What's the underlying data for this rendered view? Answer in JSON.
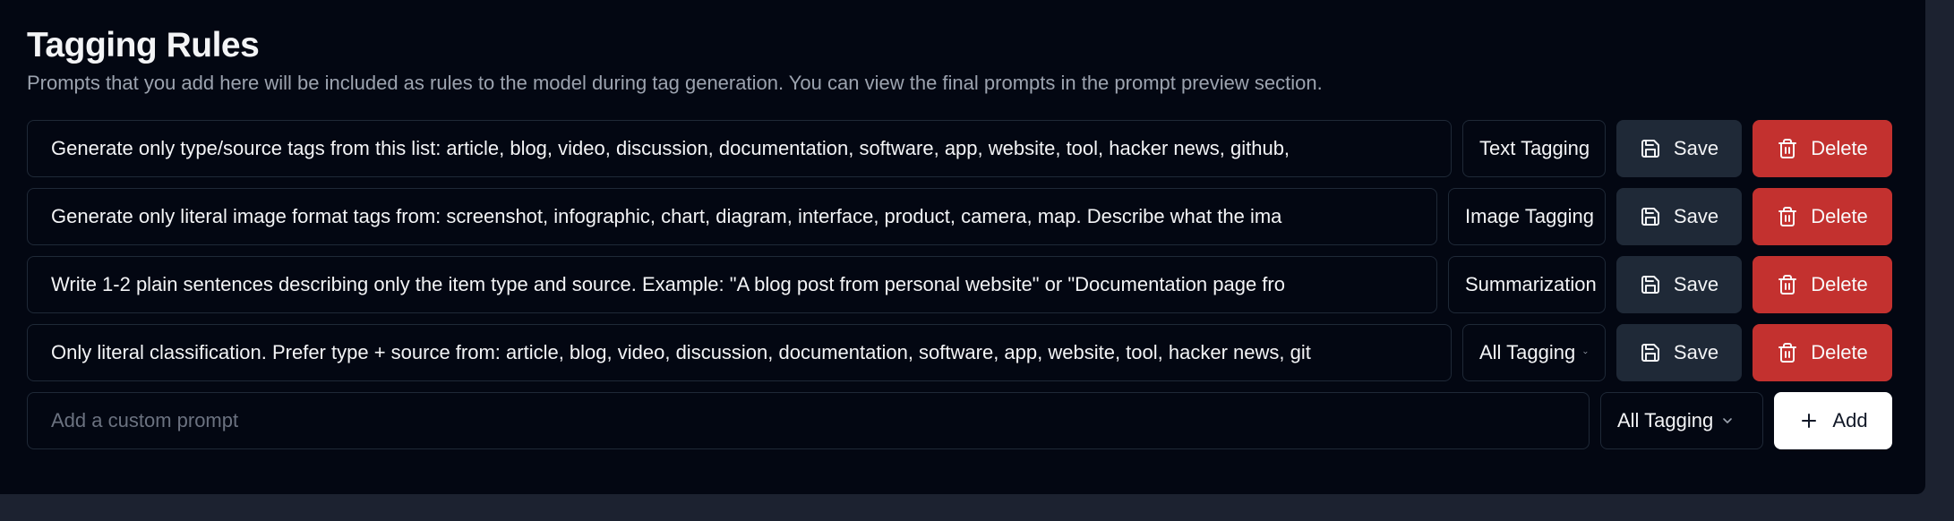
{
  "header": {
    "title": "Tagging Rules",
    "subtitle": "Prompts that you add here will be included as rules to the model during tag generation. You can view the final prompts in the prompt preview section."
  },
  "rules": [
    {
      "prompt": "Generate only type/source tags from this list: article, blog, video, discussion, documentation, software, app, website, tool, hacker news, github,",
      "type": "Text Tagging",
      "save_label": "Save",
      "delete_label": "Delete"
    },
    {
      "prompt": "Generate only literal image format tags from: screenshot, infographic, chart, diagram, interface, product, camera, map. Describe what the ima",
      "type": "Image Tagging",
      "save_label": "Save",
      "delete_label": "Delete"
    },
    {
      "prompt": "Write 1-2 plain sentences describing only the item type and source. Example: \"A blog post from personal website\" or \"Documentation page fro",
      "type": "Summarization",
      "save_label": "Save",
      "delete_label": "Delete"
    },
    {
      "prompt": "Only literal classification. Prefer type + source from: article, blog, video, discussion, documentation, software, app, website, tool, hacker news, git",
      "type": "All Tagging",
      "save_label": "Save",
      "delete_label": "Delete"
    }
  ],
  "new_rule": {
    "placeholder": "Add a custom prompt",
    "type": "All Tagging",
    "add_label": "Add"
  },
  "colors": {
    "background": "#030712",
    "delete": "#c3312f",
    "save": "#1f2937",
    "add": "#ffffff"
  }
}
